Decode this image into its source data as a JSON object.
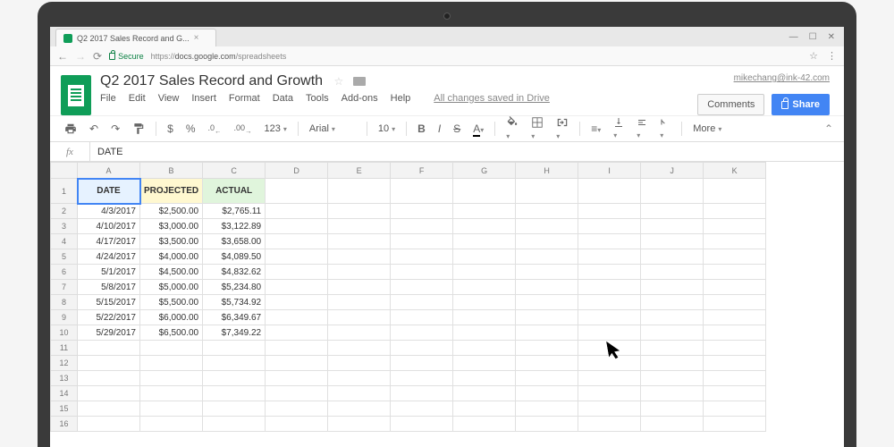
{
  "browser": {
    "tab_title": "Q2 2017 Sales Record and G...",
    "url_prefix": "Secure",
    "url_host": "https://",
    "url_bold": "docs.google.com",
    "url_path": "/spreadsheets"
  },
  "header": {
    "doc_title": "Q2 2017 Sales Record and Growth",
    "email": "mikechang@ink-42.com",
    "comments_btn": "Comments",
    "share_btn": "Share",
    "saved_msg": "All changes saved in Drive",
    "menus": [
      "File",
      "Edit",
      "View",
      "Insert",
      "Format",
      "Data",
      "Tools",
      "Add-ons",
      "Help"
    ]
  },
  "toolbar": {
    "currency": "$",
    "percent": "%",
    "dec1": ".0",
    "dec2": ".00",
    "num_format": "123",
    "font": "Arial",
    "size": "10",
    "more": "More"
  },
  "formula": {
    "label": "fx",
    "value": "DATE"
  },
  "grid": {
    "columns": [
      "A",
      "B",
      "C",
      "D",
      "E",
      "F",
      "G",
      "H",
      "I",
      "J",
      "K"
    ],
    "row_count": 16,
    "headers": [
      "DATE",
      "PROJECTED",
      "ACTUAL"
    ],
    "rows": [
      {
        "date": "4/3/2017",
        "proj": "$2,500.00",
        "act": "$2,765.11"
      },
      {
        "date": "4/10/2017",
        "proj": "$3,000.00",
        "act": "$3,122.89"
      },
      {
        "date": "4/17/2017",
        "proj": "$3,500.00",
        "act": "$3,658.00"
      },
      {
        "date": "4/24/2017",
        "proj": "$4,000.00",
        "act": "$4,089.50"
      },
      {
        "date": "5/1/2017",
        "proj": "$4,500.00",
        "act": "$4,832.62"
      },
      {
        "date": "5/8/2017",
        "proj": "$5,000.00",
        "act": "$5,234.80"
      },
      {
        "date": "5/15/2017",
        "proj": "$5,500.00",
        "act": "$5,734.92"
      },
      {
        "date": "5/22/2017",
        "proj": "$6,000.00",
        "act": "$6,349.67"
      },
      {
        "date": "5/29/2017",
        "proj": "$6,500.00",
        "act": "$7,349.22"
      }
    ]
  }
}
